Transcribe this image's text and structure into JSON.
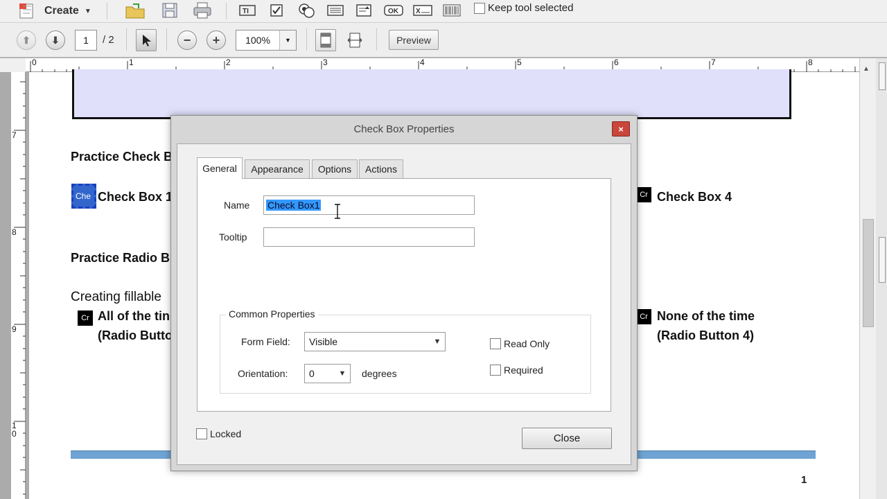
{
  "toolbar": {
    "create_label": "Create",
    "keep_tool_label": "Keep tool selected",
    "current_page": "1",
    "page_total": "/ 2",
    "zoom": "100%",
    "preview_label": "Preview",
    "icons": [
      "text-field-icon",
      "checkbox-icon",
      "radio-icon",
      "list-box-icon",
      "dropdown-icon",
      "ok-button-icon",
      "digital-signature-icon",
      "barcode-icon"
    ]
  },
  "ruler": {
    "h_ticks": [
      "0",
      "1",
      "2",
      "3",
      "4",
      "5",
      "6",
      "7",
      "8"
    ],
    "v_ticks": [
      "7",
      "8",
      "9",
      "1\n0"
    ]
  },
  "document": {
    "heading_checkbox": "Practice Check B",
    "checkbox1_label": "Check Box 1",
    "checkbox1_field": "Che",
    "checkbox4_label": "Check Box 4",
    "heading_radio": "Practice Radio B",
    "creating_label": "Creating fillable",
    "radio1_line1": "All of the tin",
    "radio1_line2": "(Radio Butto",
    "radio4_line1": "None of the time",
    "radio4_line2": "(Radio Button 4)",
    "field_tag": "Cr",
    "page_number": "1"
  },
  "dialog": {
    "title": "Check Box Properties",
    "close_x": "×",
    "tabs": [
      {
        "label": "General"
      },
      {
        "label": "Appearance"
      },
      {
        "label": "Options"
      },
      {
        "label": "Actions"
      }
    ],
    "name_label": "Name",
    "name_value": "Check Box1",
    "tooltip_label": "Tooltip",
    "tooltip_value": "",
    "common_properties": "Common Properties",
    "form_field_label": "Form Field:",
    "form_field_value": "Visible",
    "orientation_label": "Orientation:",
    "orientation_value": "0",
    "degrees_label": "degrees",
    "read_only_label": "Read Only",
    "required_label": "Required",
    "locked_label": "Locked",
    "close_button": "Close"
  },
  "colors": {
    "header_box": "#e0e0fa",
    "selection": "#3366cc",
    "rule_bar": "#6fa3d3",
    "close_red": "#c8463a"
  }
}
